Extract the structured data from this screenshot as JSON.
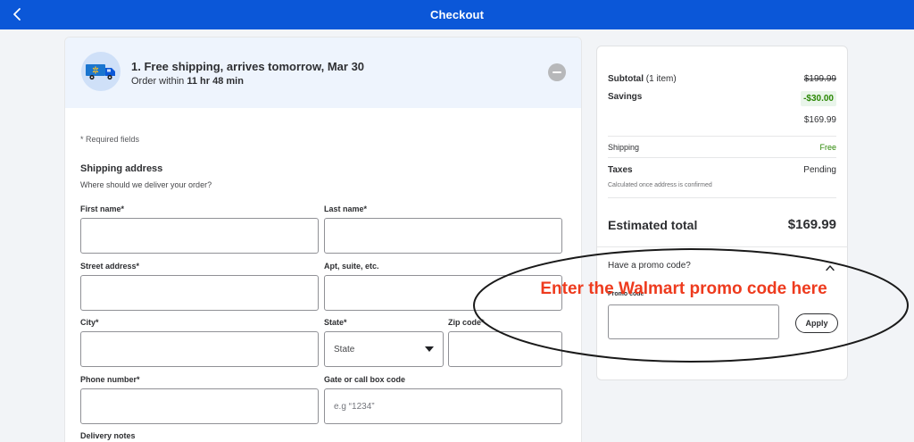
{
  "header": {
    "title": "Checkout",
    "bar_color": "#0b57d8",
    "back_icon": "chevron-left-icon"
  },
  "shipping_banner": {
    "title": "1. Free shipping, arrives tomorrow, Mar 30",
    "order_prefix": "Order within",
    "order_time": "11 hr 48 min",
    "truck_icon": "delivery-truck-icon",
    "collapse_icon": "minus-circle-icon"
  },
  "form": {
    "required_note": "* Required fields",
    "section_title": "Shipping address",
    "section_subtitle": "Where should we deliver your order?",
    "fields": {
      "first_name": {
        "label": "First name*",
        "value": ""
      },
      "last_name": {
        "label": "Last name*",
        "value": ""
      },
      "street": {
        "label": "Street address*",
        "value": ""
      },
      "apt": {
        "label": "Apt, suite, etc.",
        "value": ""
      },
      "city": {
        "label": "City*",
        "value": ""
      },
      "state": {
        "label": "State*",
        "value": "State"
      },
      "zip": {
        "label": "Zip code*",
        "value": ""
      },
      "phone": {
        "label": "Phone number*",
        "value": ""
      },
      "gate": {
        "label": "Gate or call box code",
        "value": "",
        "placeholder": "e.g “1234”"
      },
      "delivery_notes": {
        "label": "Delivery notes"
      }
    }
  },
  "summary": {
    "subtotal_label": "Subtotal",
    "subtotal_count": "(1 item)",
    "subtotal_original": "$199.99",
    "savings_label": "Savings",
    "savings_value": "-$30.00",
    "subtotal_after": "$169.99",
    "shipping_label": "Shipping",
    "shipping_value": "Free",
    "taxes_label": "Taxes",
    "taxes_value": "Pending",
    "taxes_note": "Calculated once address is confirmed",
    "total_label": "Estimated total",
    "total_value": "$169.99",
    "promo_question": "Have a promo code?",
    "promo_label": "Promo code*",
    "promo_value": "",
    "apply_label": "Apply",
    "savings_color": "#2a8703"
  },
  "annotation": {
    "text": "Enter the Walmart promo code here",
    "color": "#ee3b1e"
  }
}
